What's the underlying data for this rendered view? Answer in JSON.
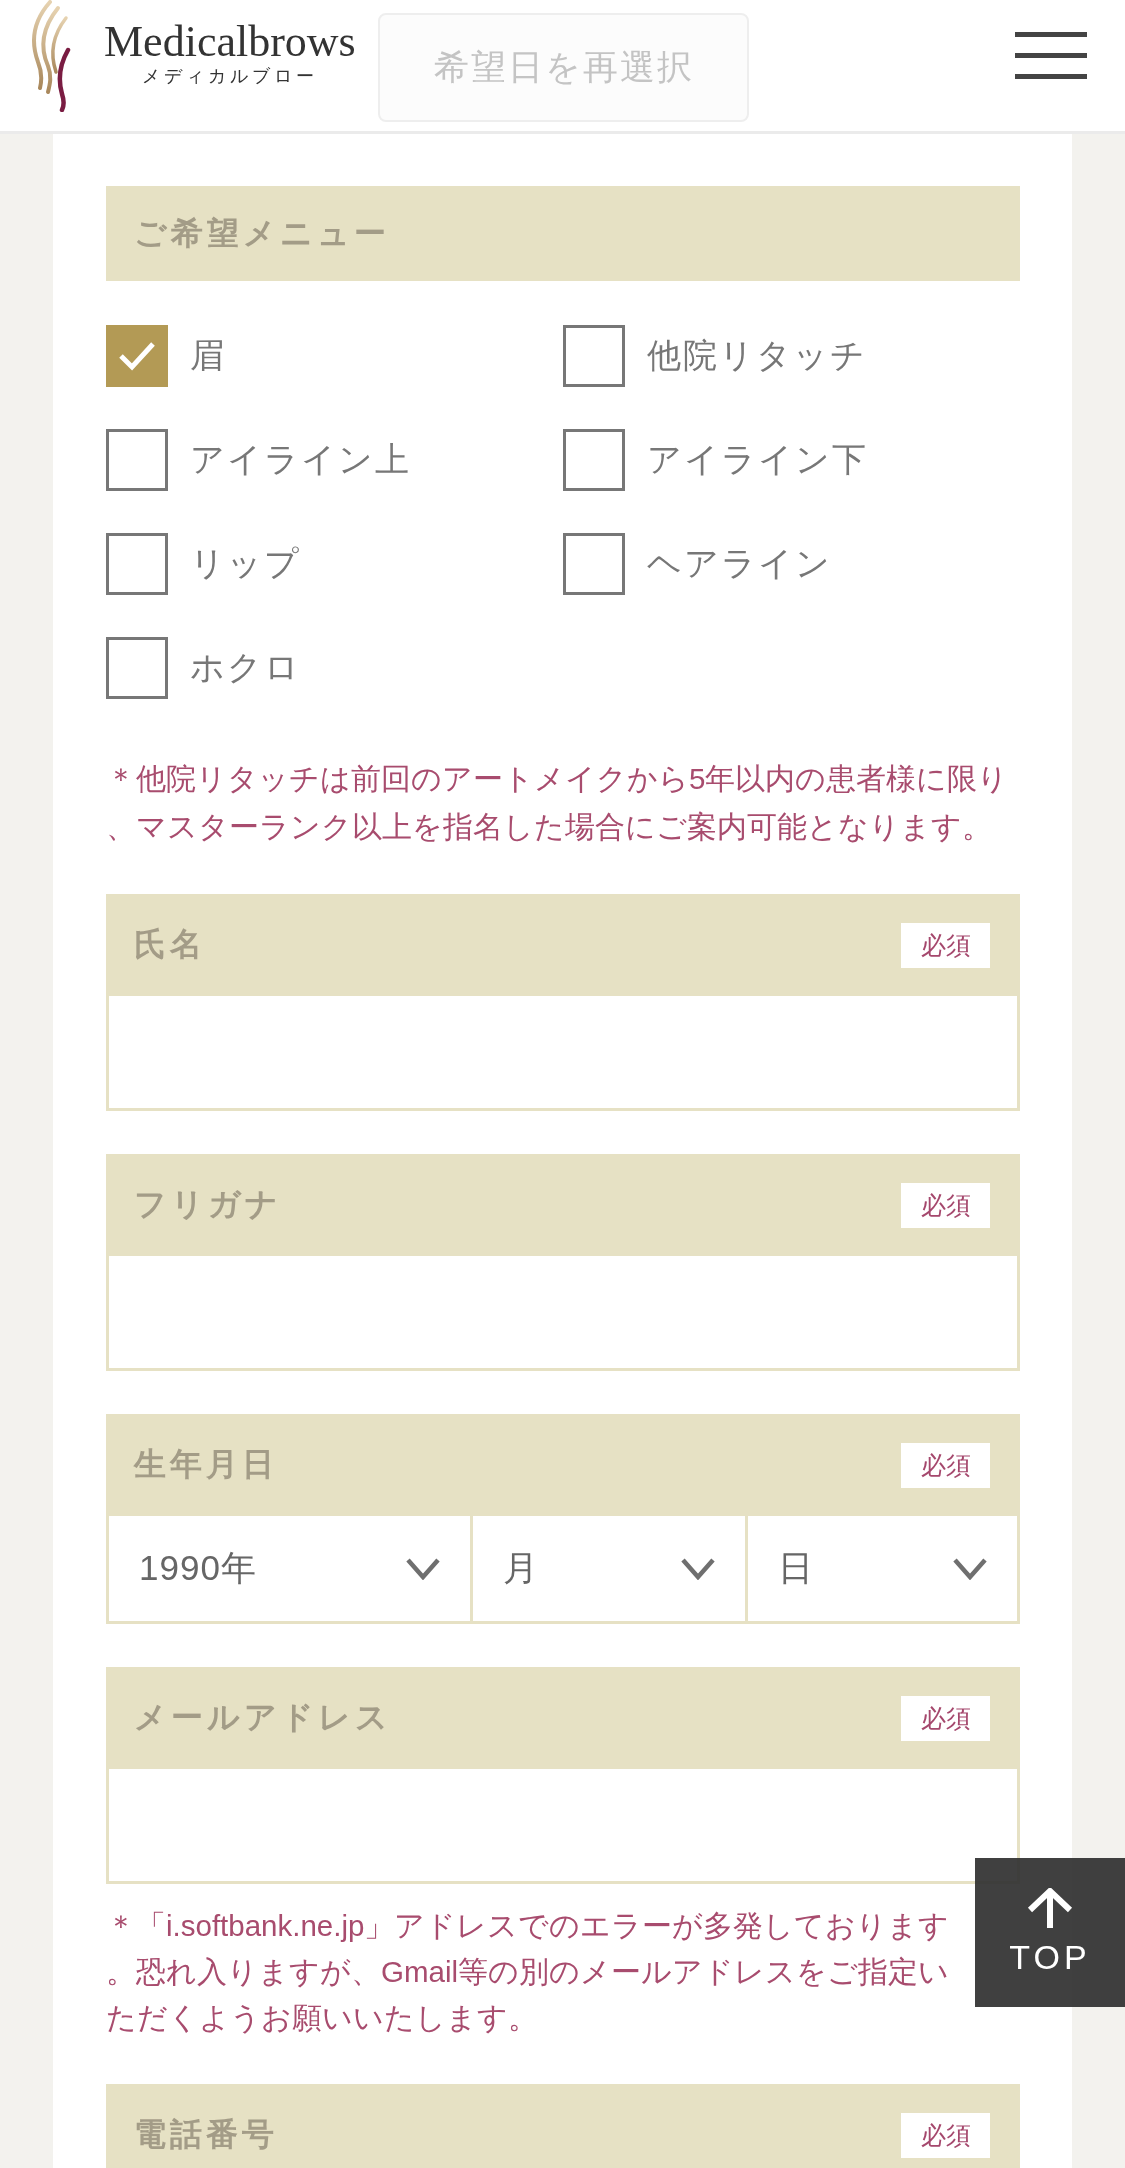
{
  "header": {
    "logo": {
      "name": "Medicalbrows",
      "subtitle": "メディカルブロー"
    },
    "reselect_button": "希望日を再選択"
  },
  "menu": {
    "title": "ご希望メニュー",
    "options": [
      {
        "label": "眉",
        "checked": true
      },
      {
        "label": "他院リタッチ",
        "checked": false
      },
      {
        "label": "アイライン上",
        "checked": false
      },
      {
        "label": "アイライン下",
        "checked": false
      },
      {
        "label": "リップ",
        "checked": false
      },
      {
        "label": "ヘアライン",
        "checked": false
      },
      {
        "label": "ホクロ",
        "checked": false
      }
    ],
    "note": "＊他院リタッチは前回のアートメイクから5年以内の患者様に限り、マスターランク以上を指名した場合にご案内可能となります。"
  },
  "fields": [
    {
      "kind": "text",
      "label": "氏名",
      "badge": "必須"
    },
    {
      "kind": "text",
      "label": "フリガナ",
      "badge": "必須"
    },
    {
      "kind": "date",
      "label": "生年月日",
      "badge": "必須",
      "selects": [
        {
          "value": "1990年"
        },
        {
          "value": "月"
        },
        {
          "value": "日"
        }
      ]
    },
    {
      "kind": "text",
      "label": "メールアドレス",
      "badge": "必須",
      "note": "＊「i.softbank.ne.jp」アドレスでのエラーが多発しております。恐れ入りますが、Gmail等の別のメールアドレスをご指定いただくようお願いいたします。"
    },
    {
      "label": "電話番号",
      "badge": "必須"
    }
  ],
  "top_button": {
    "label": "TOP"
  }
}
